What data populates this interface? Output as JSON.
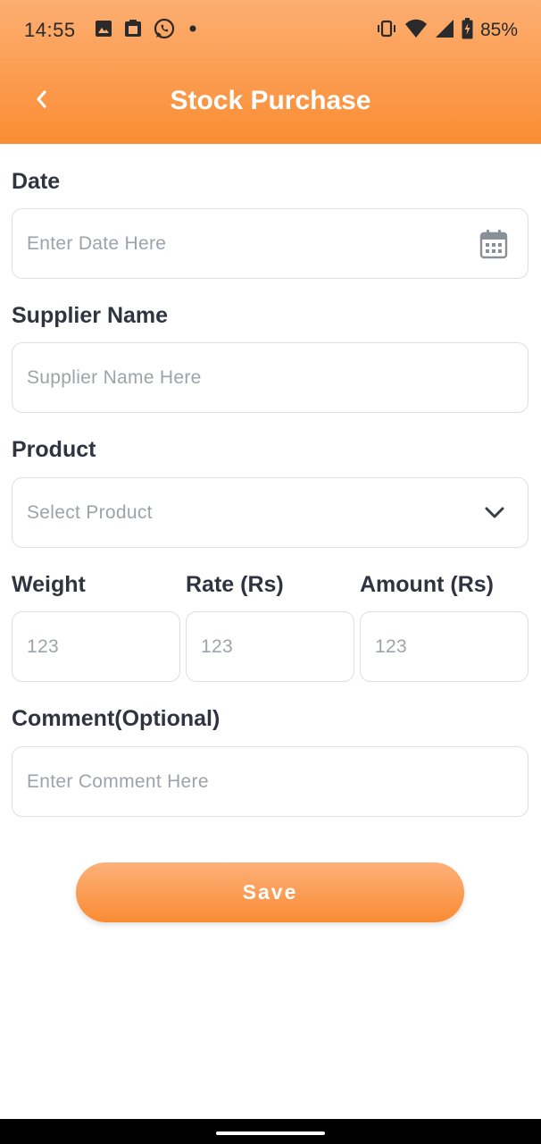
{
  "status_bar": {
    "time": "14:55",
    "battery": "85%",
    "icons_left": [
      "image-icon",
      "clipboard-icon",
      "whatsapp-icon",
      "dot-icon"
    ],
    "icons_right": [
      "vibrate-icon",
      "wifi-icon",
      "signal-icon",
      "battery-charging-icon"
    ]
  },
  "header": {
    "title": "Stock Purchase",
    "back_icon": "chevron-left-icon"
  },
  "form": {
    "date": {
      "label": "Date",
      "placeholder": "Enter Date Here",
      "icon": "calendar-icon"
    },
    "supplier": {
      "label": "Supplier Name",
      "placeholder": "Supplier Name Here"
    },
    "product": {
      "label": "Product",
      "placeholder": "Select Product",
      "icon": "chevron-down-icon"
    },
    "weight": {
      "label": "Weight",
      "placeholder": "123"
    },
    "rate": {
      "label": "Rate (Rs)",
      "placeholder": "123"
    },
    "amount": {
      "label": "Amount (Rs)",
      "placeholder": "123"
    },
    "comment": {
      "label": "Comment(Optional)",
      "placeholder": "Enter Comment Here"
    }
  },
  "save_button": {
    "label": "Save"
  },
  "colors": {
    "accent_light": "#fcae72",
    "accent_dark": "#fa8d33",
    "label_text": "#2f3440",
    "placeholder_text": "#9ea3aa",
    "border": "#dcdfe3"
  }
}
